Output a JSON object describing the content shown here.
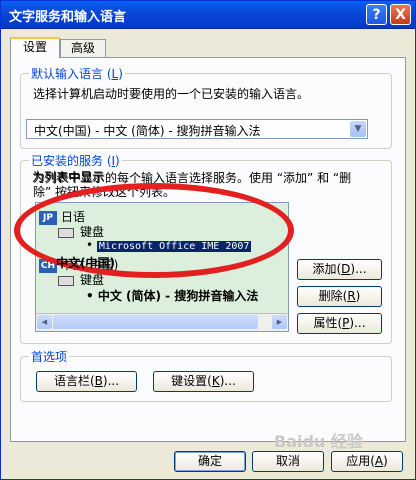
{
  "window": {
    "title": "文字服务和输入语言",
    "help_label": "?",
    "close_label": "X"
  },
  "tabs": [
    {
      "label": "设置"
    },
    {
      "label": "高级"
    }
  ],
  "default_lang": {
    "title_prefix": "默认输入语言 (",
    "title_key": "L",
    "title_suffix": ")",
    "desc": "选择计算机启动时要使用的一个已安装的输入语言。",
    "selected_value": "中文(中国) - 中文 (简体) - 搜狗拼音输入法",
    "dropdown_arrow": "▼"
  },
  "services": {
    "title_prefix": "已安装的服务 (",
    "title_key": "I",
    "title_suffix": ")",
    "desc_line1": "为列表中显示的每个输入语言选择服务。使用 “添加” 和 “删",
    "desc_line2": "除” 按钮来修改这个列表。",
    "tree": [
      {
        "badge": "JP",
        "lang": "日语",
        "group": "键盘",
        "service": "Microsoft Office IME 2007"
      },
      {
        "badge": "CH",
        "lang": "中文(中国)",
        "group": "键盘",
        "service": "中文 (简体) - 搜狗拼音输入法"
      }
    ],
    "bullet": "•"
  },
  "buttons": {
    "add": {
      "prefix": "添加(",
      "key": "D",
      "suffix": ")..."
    },
    "remove": {
      "prefix": "删除(",
      "key": "R",
      "suffix": ")"
    },
    "properties": {
      "prefix": "属性(",
      "key": "P",
      "suffix": ")..."
    },
    "lang_bar": {
      "prefix": "语言栏(",
      "key": "B",
      "suffix": ")..."
    },
    "key_settings": {
      "prefix": "键设置(",
      "key": "K",
      "suffix": ")..."
    },
    "ok": "确定",
    "cancel": "取消",
    "apply": {
      "prefix": "应用(",
      "key": "A",
      "suffix": ")"
    }
  },
  "preferences": {
    "title": "首选项"
  },
  "overlay": {
    "frag1": "为列表中显示",
    "frag2": "除” 按钮来修",
    "frag3": "中文(中国)"
  },
  "watermark": "Baidu 经验",
  "colors": {
    "annotation_ellipse": "#e32020",
    "title_bar": "#0a49d8",
    "group_title": "#0046d5"
  }
}
